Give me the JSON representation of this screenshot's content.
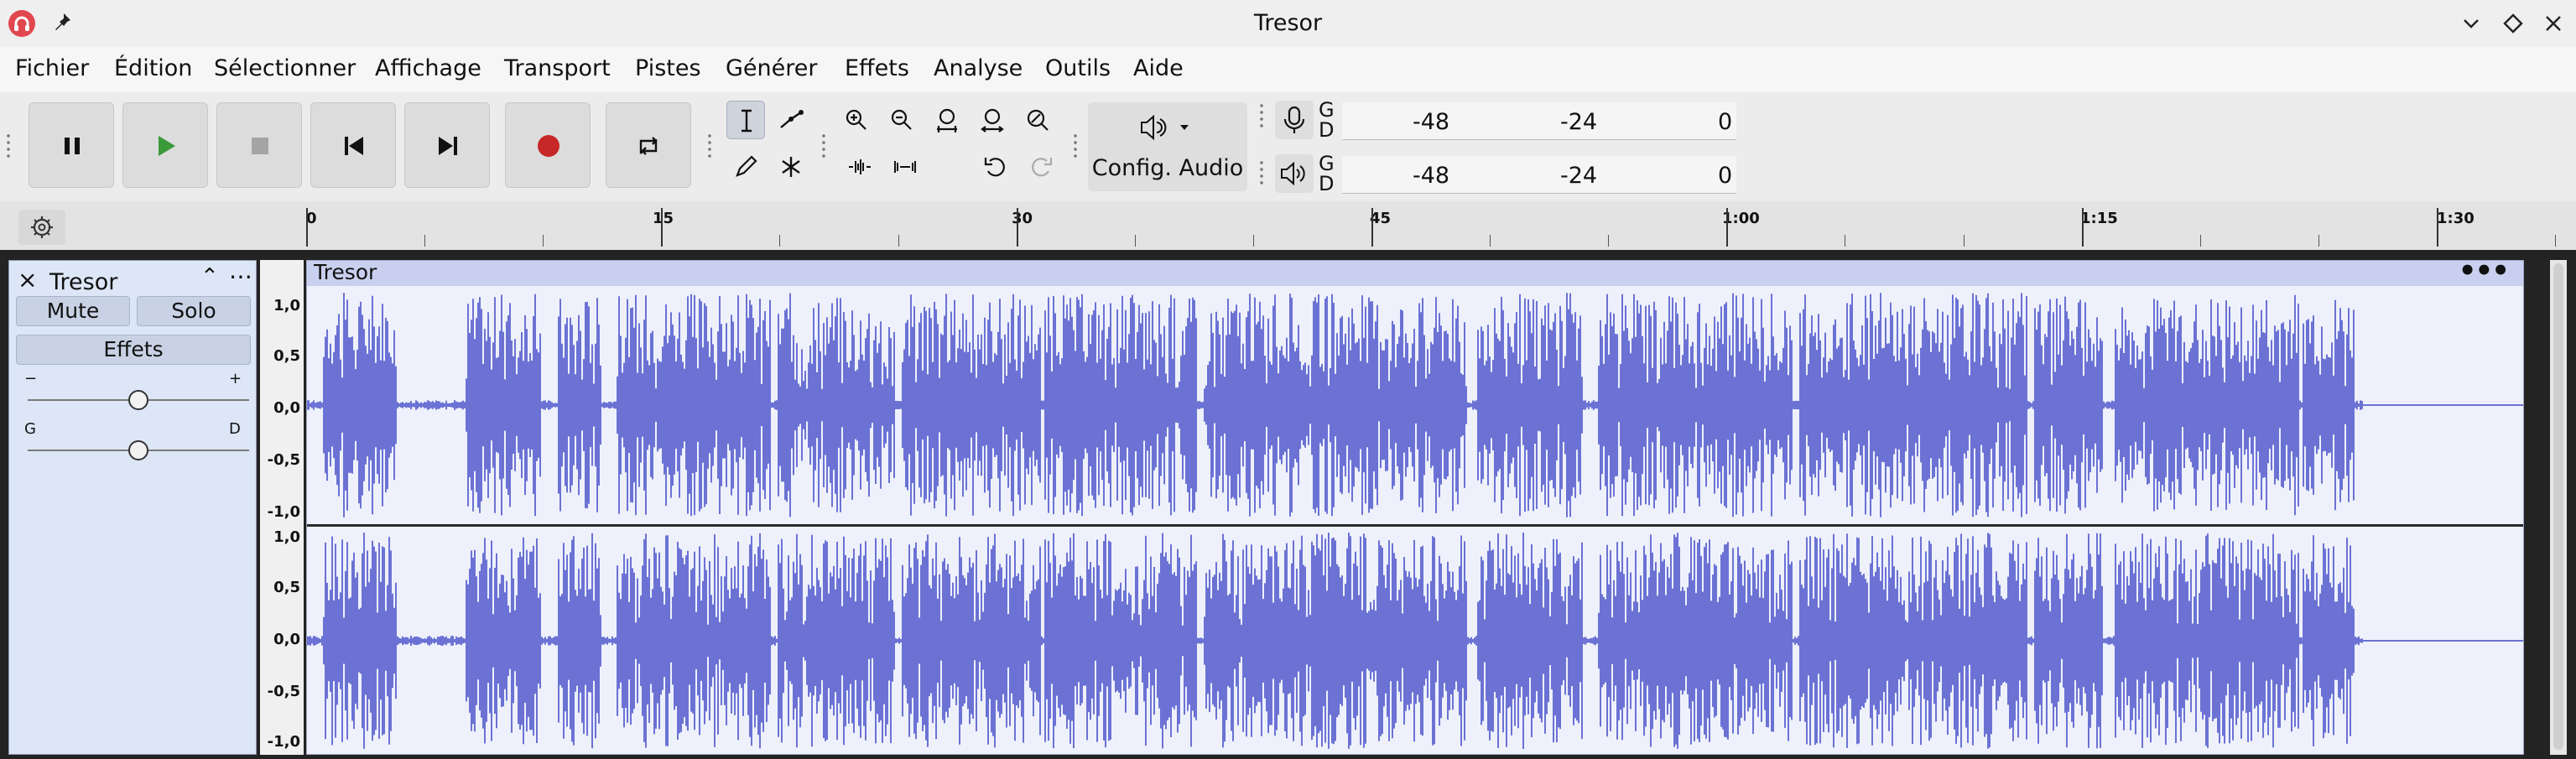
{
  "window": {
    "title": "Tresor"
  },
  "menu": {
    "items": [
      "Fichier",
      "Édition",
      "Sélectionner",
      "Affichage",
      "Transport",
      "Pistes",
      "Générer",
      "Effets",
      "Analyse",
      "Outils",
      "Aide"
    ]
  },
  "toolbar": {
    "transport_icons": [
      "pause-icon",
      "play-icon",
      "stop-icon",
      "skip-start-icon",
      "skip-end-icon",
      "record-icon",
      "loop-icon"
    ],
    "audio_setup_label": "Config. Audio",
    "record_meter": {
      "left": "G",
      "right": "D",
      "ticks": [
        "-48",
        "-24",
        "0"
      ]
    },
    "playback_meter": {
      "left": "G",
      "right": "D",
      "ticks": [
        "-48",
        "-24",
        "0"
      ]
    },
    "colors": {
      "play": "#3a9a3a",
      "record": "#c62828"
    }
  },
  "ruler": {
    "labels": [
      "0",
      "15",
      "30",
      "45",
      "1:00",
      "1:15",
      "1:30"
    ]
  },
  "track": {
    "name": "Tresor",
    "mute_label": "Mute",
    "solo_label": "Solo",
    "effects_label": "Effets",
    "gain_minus": "−",
    "gain_plus": "+",
    "pan_left": "G",
    "pan_right": "D",
    "gain_level": 0.5,
    "pan_level": 0.5,
    "scale_labels": [
      "1,0",
      "0,5",
      "0,0",
      "-0,5",
      "-1,0"
    ],
    "clip_name": "Tresor",
    "clip_menu": "•••",
    "wave_color": "#6b72d4"
  }
}
